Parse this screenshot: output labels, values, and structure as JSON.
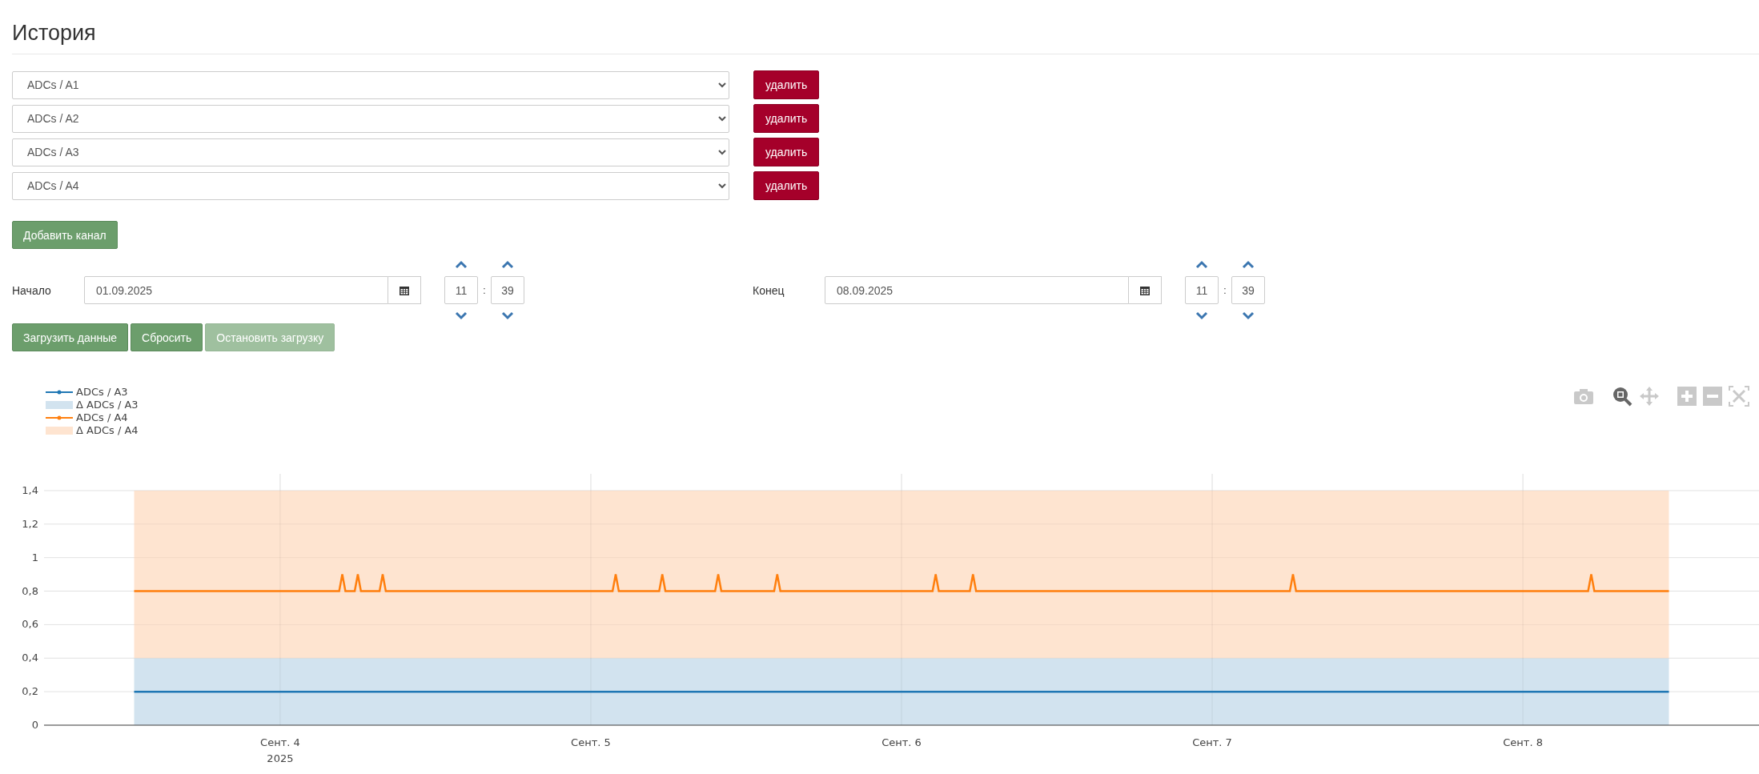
{
  "page_title": "История",
  "channels": [
    {
      "value": "ADCs / A1",
      "remove_label": "удалить"
    },
    {
      "value": "ADCs / A2",
      "remove_label": "удалить"
    },
    {
      "value": "ADCs / A3",
      "remove_label": "удалить"
    },
    {
      "value": "ADCs / A4",
      "remove_label": "удалить"
    }
  ],
  "add_channel_label": "Добавить канал",
  "ranges": [
    {
      "label": "Начало",
      "date": "01.09.2025",
      "hour": "11",
      "minute": "39",
      "separator": ":"
    },
    {
      "label": "Конец",
      "date": "08.09.2025",
      "hour": "11",
      "minute": "39",
      "separator": ":"
    }
  ],
  "actions": [
    {
      "label": "Загрузить данные",
      "disabled": false
    },
    {
      "label": "Сбросить",
      "disabled": false
    },
    {
      "label": "Остановить загрузку",
      "disabled": true
    }
  ],
  "toolbar": [
    {
      "selected": false
    },
    {
      "selected": true
    },
    {
      "selected": false
    },
    {
      "selected": false
    },
    {
      "selected": false
    },
    {
      "selected": false
    }
  ],
  "chart": {
    "year_label": "2025",
    "chart_data": {
      "type": "line",
      "stacked": true,
      "grid": true,
      "x": [
        3.53,
        4.19,
        4.2,
        4.21,
        4.24,
        4.25,
        4.26,
        4.32,
        4.33,
        4.34,
        5.07,
        5.08,
        5.09,
        5.22,
        5.23,
        5.24,
        5.4,
        5.41,
        5.42,
        5.59,
        5.6,
        5.61,
        6.1,
        6.11,
        6.12,
        6.22,
        6.23,
        6.24,
        7.25,
        7.26,
        7.27,
        8.21,
        8.22,
        8.23,
        8.47
      ],
      "series": [
        {
          "name": "ADCs / A3",
          "type": "line",
          "color": "#1f77b4",
          "values": [
            0.2,
            0.2,
            0.2,
            0.2,
            0.2,
            0.2,
            0.2,
            0.2,
            0.2,
            0.2,
            0.2,
            0.2,
            0.2,
            0.2,
            0.2,
            0.2,
            0.2,
            0.2,
            0.2,
            0.2,
            0.2,
            0.2,
            0.2,
            0.2,
            0.2,
            0.2,
            0.2,
            0.2,
            0.2,
            0.2,
            0.2,
            0.2,
            0.2,
            0.2,
            0.2
          ]
        },
        {
          "name": "Δ ADCs / A3",
          "type": "area",
          "color": "#d2e3ef",
          "values": [
            0.4,
            0.4,
            0.4,
            0.4,
            0.4,
            0.4,
            0.4,
            0.4,
            0.4,
            0.4,
            0.4,
            0.4,
            0.4,
            0.4,
            0.4,
            0.4,
            0.4,
            0.4,
            0.4,
            0.4,
            0.4,
            0.4,
            0.4,
            0.4,
            0.4,
            0.4,
            0.4,
            0.4,
            0.4,
            0.4,
            0.4,
            0.4,
            0.4,
            0.4,
            0.4
          ]
        },
        {
          "name": "ADCs / A4",
          "type": "line",
          "color": "#ff7f0e",
          "values": [
            0.8,
            0.8,
            0.9,
            0.8,
            0.8,
            0.9,
            0.8,
            0.8,
            0.9,
            0.8,
            0.8,
            0.9,
            0.8,
            0.8,
            0.9,
            0.8,
            0.8,
            0.9,
            0.8,
            0.8,
            0.9,
            0.8,
            0.8,
            0.9,
            0.8,
            0.8,
            0.9,
            0.8,
            0.8,
            0.9,
            0.8,
            0.8,
            0.9,
            0.8,
            0.8
          ]
        },
        {
          "name": "Δ ADCs / A4",
          "type": "area",
          "color": "#fee4d0",
          "values": [
            1.0,
            1.0,
            1.0,
            1.0,
            1.0,
            1.0,
            1.0,
            1.0,
            1.0,
            1.0,
            1.0,
            1.0,
            1.0,
            1.0,
            1.0,
            1.0,
            1.0,
            1.0,
            1.0,
            1.0,
            1.0,
            1.0,
            1.0,
            1.0,
            1.0,
            1.0,
            1.0,
            1.0,
            1.0,
            1.0,
            1.0,
            1.0,
            1.0,
            1.0,
            1.0
          ]
        }
      ],
      "xlim": [
        3.24,
        8.76
      ],
      "ylim": [
        0,
        1.5
      ],
      "xticks": [
        {
          "value": 4,
          "label": "Сент. 4"
        },
        {
          "value": 5,
          "label": "Сент. 5"
        },
        {
          "value": 6,
          "label": "Сент. 6"
        },
        {
          "value": 7,
          "label": "Сент. 7"
        },
        {
          "value": 8,
          "label": "Сент. 8"
        }
      ],
      "yticks": [
        {
          "value": 0,
          "label": "0"
        },
        {
          "value": 0.2,
          "label": "0,2"
        },
        {
          "value": 0.4,
          "label": "0,4"
        },
        {
          "value": 0.6,
          "label": "0,6"
        },
        {
          "value": 0.8,
          "label": "0,8"
        },
        {
          "value": 1,
          "label": "1"
        },
        {
          "value": 1.2,
          "label": "1,2"
        },
        {
          "value": 1.4,
          "label": "1,4"
        }
      ]
    }
  }
}
